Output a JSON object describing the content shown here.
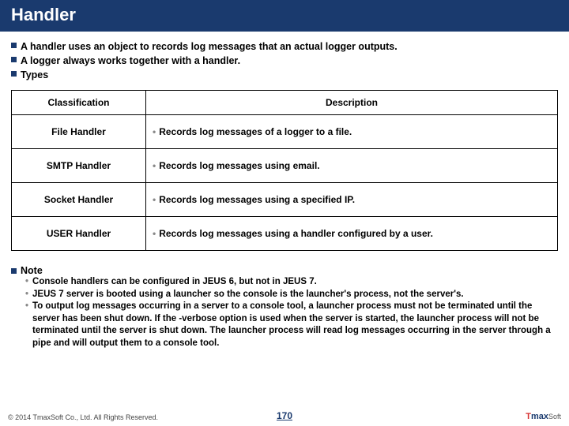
{
  "title": "Handler",
  "bullets": [
    "A handler uses an object to records log messages that an actual logger outputs.",
    "A logger always works together with a handler.",
    "Types"
  ],
  "table": {
    "headers": {
      "cls": "Classification",
      "desc": "Description"
    },
    "rows": [
      {
        "cls": "File Handler",
        "desc": "Records log messages of a logger to a file."
      },
      {
        "cls": "SMTP Handler",
        "desc": "Records log messages using email."
      },
      {
        "cls": "Socket Handler",
        "desc": "Records log messages using a specified IP."
      },
      {
        "cls": "USER Handler",
        "desc": "Records log messages using a handler configured by a user."
      }
    ]
  },
  "note": {
    "label": "Note",
    "items": [
      "Console handlers can be configured in JEUS 6, but not in JEUS 7.",
      "JEUS 7 server is booted using a launcher so the console is the launcher's process, not the server's.",
      "To output log messages occurring in a server to a console tool, a launcher process must not be terminated until the server has been shut down. If the -verbose option is used when the server is started, the launcher process will not be terminated until the server is shut down. The launcher process will read log messages occurring in the server through a pipe and will output them to a console tool."
    ]
  },
  "footer": {
    "copyright": "© 2014 TmaxSoft Co., Ltd. All Rights Reserved.",
    "page": "170",
    "logo": {
      "t": "T",
      "max": "max",
      "soft": "Soft"
    }
  }
}
